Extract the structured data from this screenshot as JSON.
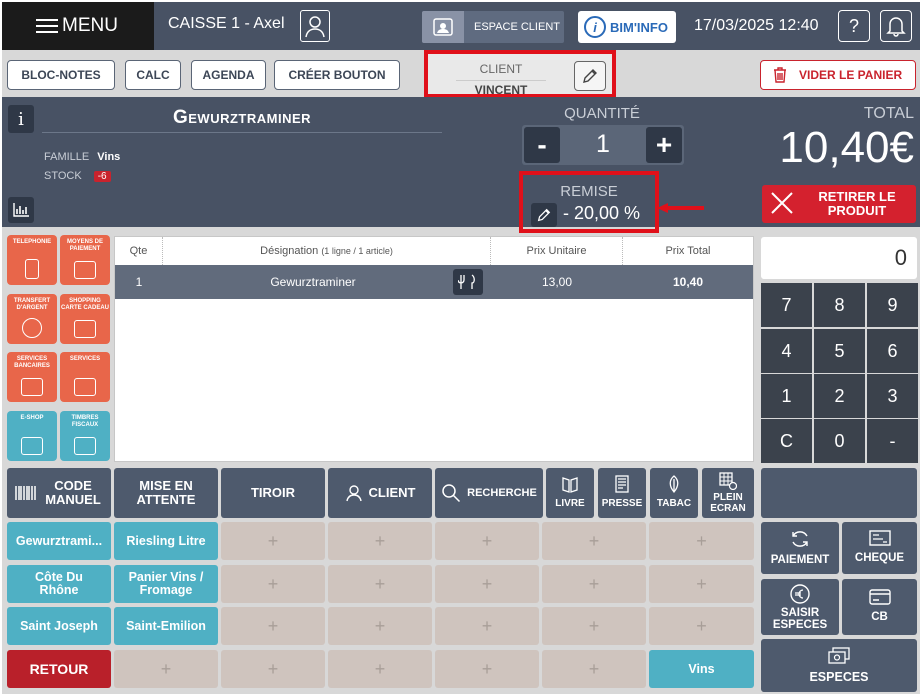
{
  "topbar": {
    "menu_label": "MENU",
    "register": "CAISSE 1 - Axel",
    "espace_client": "ESPACE CLIENT",
    "bim_info": "BIM'INFO",
    "datetime": "17/03/2025 12:40",
    "help_glyph": "?"
  },
  "toolbar": {
    "bloc_notes": "BLOC-NOTES",
    "calc": "CALC",
    "agenda": "AGENDA",
    "creer_bouton": "CRÉER BOUTON",
    "client_label": "CLIENT",
    "client_name": "VINCENT",
    "vider_panier": "VIDER LE PANIER"
  },
  "product": {
    "name": "Gewurztraminer",
    "famille_label": "FAMILLE",
    "famille_value": "Vins",
    "stock_label": "STOCK",
    "stock_value": "-6",
    "quantity_label": "QUANTITÉ",
    "quantity": "1",
    "minus": "-",
    "plus": "+",
    "remise_label": "REMISE",
    "remise_value": "- 20,00 %",
    "total_label": "TOTAL",
    "total_value": "10,40€",
    "retirer": "RETIRER LE PRODUIT"
  },
  "categories": [
    {
      "label": "TELEPHONIE",
      "color": "#e8664a"
    },
    {
      "label": "MOYENS DE PAIEMENT",
      "color": "#e8664a"
    },
    {
      "label": "TRANSFERT D'ARGENT",
      "color": "#e8664a"
    },
    {
      "label": "SHOPPING CARTE CADEAU",
      "color": "#e8664a"
    },
    {
      "label": "SERVICES BANCAIRES",
      "color": "#e8664a"
    },
    {
      "label": "SERVICES",
      "color": "#e8664a"
    },
    {
      "label": "E-SHOP",
      "color": "#4fb0c4"
    },
    {
      "label": "TIMBRES FISCAUX",
      "color": "#4fb0c4"
    }
  ],
  "table": {
    "headers": {
      "qte": "Qte",
      "designation": "Désignation",
      "designation_sub": "(1 ligne / 1 article)",
      "prix_unitaire": "Prix Unitaire",
      "prix_total": "Prix Total"
    },
    "rows": [
      {
        "qte": "1",
        "designation": "Gewurztraminer",
        "prix_unitaire": "13,00",
        "prix_total": "10,40"
      }
    ]
  },
  "numpad": {
    "display": "0",
    "keys": [
      "7",
      "8",
      "9",
      "4",
      "5",
      "6",
      "1",
      "2",
      "3",
      "C",
      "0",
      "-"
    ]
  },
  "actions": {
    "code_manuel": "CODE MANUEL",
    "mise_en_attente": "MISE EN ATTENTE",
    "tiroir": "TIROIR",
    "client": "CLIENT",
    "recherche": "RECHERCHE",
    "livre": "LIVRE",
    "presse": "PRESSE",
    "tabac": "TABAC",
    "plein_ecran": "PLEIN ECRAN"
  },
  "quick_buttons": {
    "b1": "Gewurztrami...",
    "b2": "Riesling Litre",
    "b3": "Côte Du Rhône",
    "b4": "Panier Vins / Fromage",
    "b5": "Saint Joseph",
    "b6": "Saint-Emilion",
    "retour": "RETOUR",
    "vins": "Vins",
    "empty": "+"
  },
  "payment": {
    "paiement": "PAIEMENT",
    "cheque": "CHEQUE",
    "saisir_especes": "SAISIR ESPECES",
    "cb": "CB",
    "especes": "ESPECES"
  },
  "colors": {
    "header_bg": "#485264",
    "accent_red": "#d4212e",
    "teal": "#4fb0c4",
    "orange": "#e8664a",
    "highlight": "#e0101a"
  }
}
